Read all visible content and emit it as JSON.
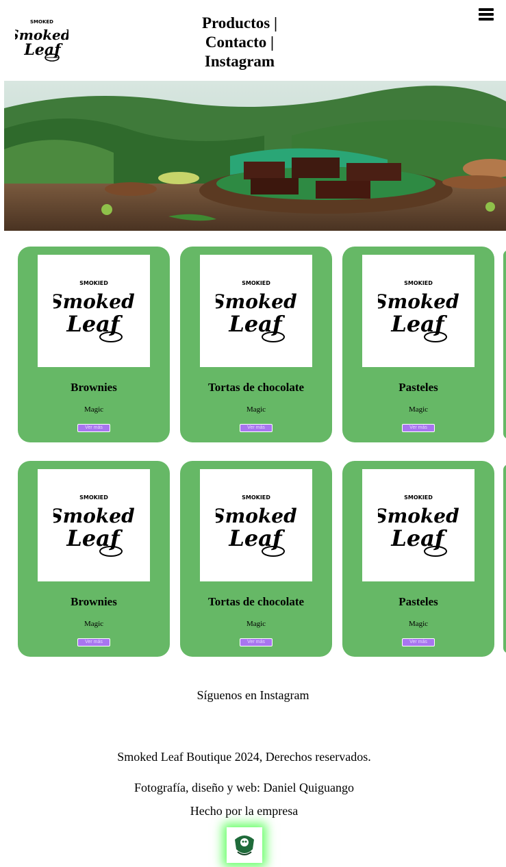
{
  "brand": {
    "logo_text_top": "SMOKED",
    "logo_text_main1": "Smoked",
    "logo_text_main2": "Leaf"
  },
  "nav": {
    "items": [
      "Productos |",
      "Contacto |",
      "Instagram"
    ]
  },
  "menu_icon": "hamburger-menu-icon",
  "hero": {
    "image": "brownies on wooden plate with jungle landscape"
  },
  "products": [
    {
      "title": "Brownies",
      "subtitle": "Magic",
      "button": "Ver más"
    },
    {
      "title": "Tortas de chocolate",
      "subtitle": "Magic",
      "button": "Ver más"
    },
    {
      "title": "Pasteles",
      "subtitle": "Magic",
      "button": "Ver más"
    },
    {
      "title": "Brownies",
      "subtitle": "Magic",
      "button": "Ver más"
    },
    {
      "title": "Tortas de chocolate",
      "subtitle": "Magic",
      "button": "Ver más"
    },
    {
      "title": "Pasteles",
      "subtitle": "Magic",
      "button": "Ver más"
    }
  ],
  "footer": {
    "follow": "Síguenos en Instagram",
    "rights": "Smoked Leaf Boutique 2024, Derechos reservados.",
    "credits": "Fotografía, diseño y web: Daniel Quiguango",
    "made_by": "Hecho por la empresa"
  },
  "colors": {
    "card": "#66b866",
    "button": "#a875f0",
    "glow": "#6bff6b"
  }
}
